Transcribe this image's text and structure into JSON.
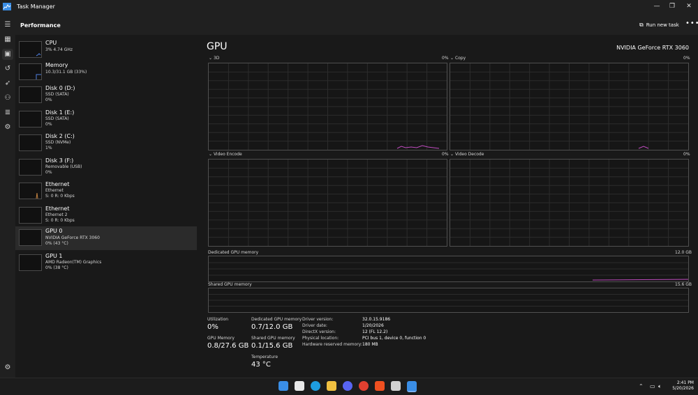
{
  "window": {
    "title": "Task Manager"
  },
  "header": {
    "title": "Performance",
    "run_new_task": "Run new task",
    "more": "•••"
  },
  "sidebar": {
    "items": [
      {
        "title": "CPU",
        "line1": "3% 4.74 GHz",
        "line2": ""
      },
      {
        "title": "Memory",
        "line1": "10.3/31.1 GB (33%)",
        "line2": ""
      },
      {
        "title": "Disk 0 (D:)",
        "line1": "SSD (SATA)",
        "line2": "0%"
      },
      {
        "title": "Disk 1 (E:)",
        "line1": "SSD (SATA)",
        "line2": "0%"
      },
      {
        "title": "Disk 2 (C:)",
        "line1": "SSD (NVMe)",
        "line2": "1%"
      },
      {
        "title": "Disk 3 (F:)",
        "line1": "Removable (USB)",
        "line2": "0%"
      },
      {
        "title": "Ethernet",
        "line1": "Ethernet",
        "line2": "S: 0 R: 0 Kbps"
      },
      {
        "title": "Ethernet",
        "line1": "Ethernet 2",
        "line2": "S: 0 R: 0 Kbps"
      },
      {
        "title": "GPU 0",
        "line1": "NVIDIA GeForce RTX 3060",
        "line2": "0% (43 °C)"
      },
      {
        "title": "GPU 1",
        "line1": "AMD Radeon(TM) Graphics",
        "line2": "0% (38 °C)"
      }
    ]
  },
  "main": {
    "title": "GPU",
    "device_name": "NVIDIA GeForce RTX 3060",
    "graphs": {
      "g3d": {
        "label": "3D",
        "percent": "0%"
      },
      "copy": {
        "label": "Copy",
        "percent": "0%"
      },
      "encode": {
        "label": "Video Encode",
        "percent": "0%"
      },
      "decode": {
        "label": "Video Decode",
        "percent": "0%"
      }
    },
    "dedicated_memory": {
      "label": "Dedicated GPU memory",
      "max": "12.0 GB"
    },
    "shared_memory": {
      "label": "Shared GPU memory",
      "max": "15.6 GB"
    },
    "stats": {
      "utilization_label": "Utilization",
      "utilization": "0%",
      "gpu_memory_label": "GPU Memory",
      "gpu_memory": "0.8/27.6 GB",
      "dedicated_label": "Dedicated GPU memory",
      "dedicated": "0.7/12.0 GB",
      "shared_label": "Shared GPU memory",
      "shared": "0.1/15.6 GB",
      "temperature_label": "Temperature",
      "temperature": "43 °C"
    },
    "info": [
      {
        "label": "Driver version:",
        "value": "32.0.15.9186"
      },
      {
        "label": "Driver date:",
        "value": "1/20/2026"
      },
      {
        "label": "DirectX version:",
        "value": "12 (FL 12.2)"
      },
      {
        "label": "Physical location:",
        "value": "PCI bus 1, device 0, function 0"
      },
      {
        "label": "Hardware reserved memory:",
        "value": "180 MB"
      }
    ]
  },
  "taskbar": {
    "time": "2:41 PM",
    "date": "5/20/2026"
  },
  "colors": {
    "accent": "#c04cc0",
    "memory_line": "#4f7fe0",
    "ethernet_line": "#c08040"
  }
}
